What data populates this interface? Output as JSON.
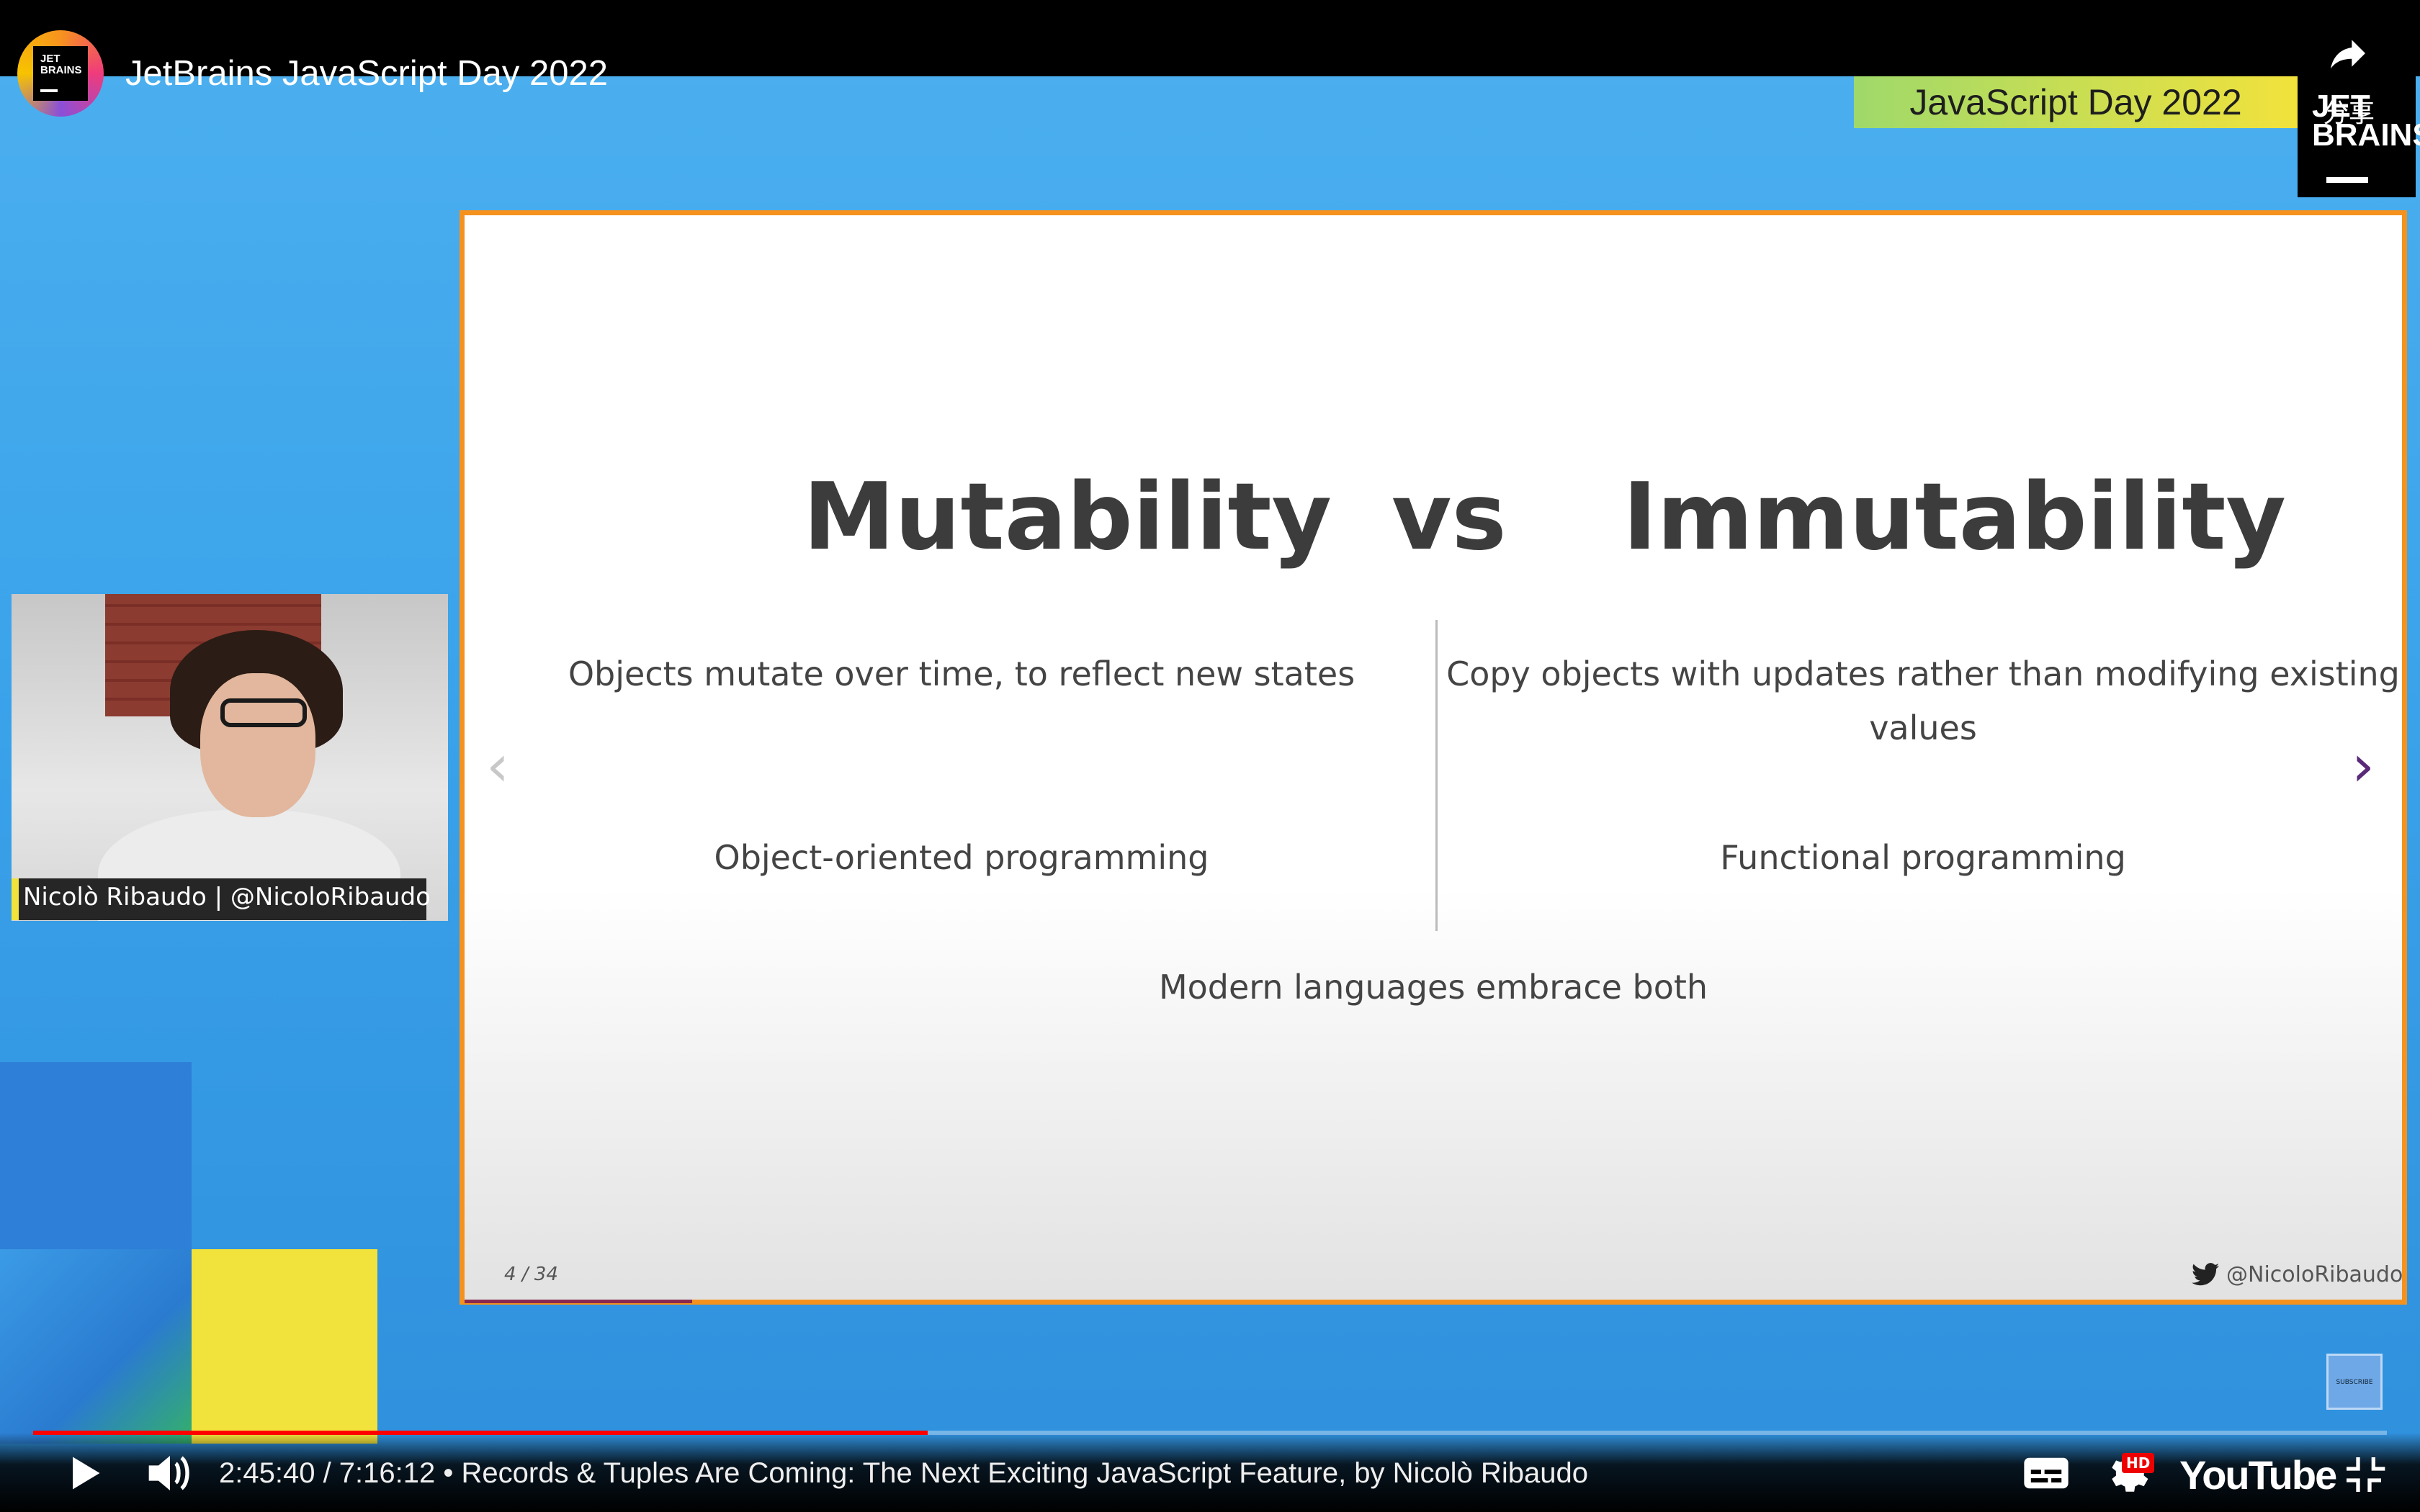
{
  "header": {
    "channel_logo_text": "JET\nBRAINS",
    "title": "JetBrains JavaScript Day 2022",
    "share_label": "分享"
  },
  "event": {
    "badge": "JavaScript Day 2022",
    "brand": "JET\nBRAINS"
  },
  "slide": {
    "heading_left": "Mutability",
    "heading_vs": "vs",
    "heading_right": "Immutability",
    "left_point_1": "Objects mutate over time, to reflect new states",
    "right_point_1": "Copy objects with updates rather than modifying existing values",
    "left_point_2": "Object-oriented programming",
    "right_point_2": "Functional programming",
    "conclusion": "Modern languages embrace both",
    "page": "4 / 34",
    "handle": "@NicoloRibaudo",
    "prev_glyph": "‹",
    "next_glyph": "›"
  },
  "speaker": {
    "name_tag": "Nicolò Ribaudo | @NicoloRibaudo"
  },
  "subscribe_label": "SUBSCRIBE",
  "player": {
    "time": "2:45:40 / 7:16:12",
    "separator": " • ",
    "video_title": "Records & Tuples Are Coming: The Next Exciting JavaScript Feature, by Nicolò Ribaudo",
    "hd_badge": "HD",
    "logo": "YouTube",
    "progress_fraction": 0.38,
    "accent_color": "#ff0000"
  }
}
